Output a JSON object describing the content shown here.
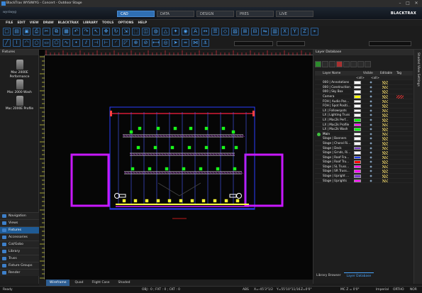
{
  "window": {
    "title": "BlackTrax WYSIWYG - Concert - Outdoor Stage",
    "controls": [
      "–",
      "□",
      "✕"
    ]
  },
  "brand": {
    "logo_left": "wysiwyg",
    "logo_right": "BLACKTRAX"
  },
  "mode_tabs": [
    {
      "label": "CAD",
      "active": true
    },
    {
      "label": "DATA",
      "active": false
    },
    {
      "label": "DESIGN",
      "active": false
    },
    {
      "label": "PRES",
      "active": false
    },
    {
      "label": "LIVE",
      "active": false
    }
  ],
  "menu": [
    "FILE",
    "EDIT",
    "VIEW",
    "DRAW",
    "BLACKTRAX",
    "LIBRARY",
    "TOOLS",
    "OPTIONS",
    "HELP"
  ],
  "toolbar": {
    "row1_icons": [
      "new-icon",
      "open-icon",
      "save-icon",
      "print-icon",
      "cut-icon",
      "copy-icon",
      "paste-icon",
      "undo-icon",
      "redo-icon",
      "select-icon",
      "move-icon",
      "rotate-icon",
      "scale-icon",
      "box-icon",
      "cylinder-icon",
      "sphere-icon",
      "cone-icon",
      "light-icon",
      "camera-icon",
      "text-icon",
      "dimension-icon",
      "layer-icon",
      "symbol-icon",
      "hatch-icon",
      "group-icon",
      "ungroup-icon",
      "mirror-icon",
      "array-icon",
      "x-axis-icon",
      "y-axis-icon",
      "z-axis-icon",
      "snap-icon"
    ],
    "row1_glyphs": [
      "□",
      "▤",
      "▣",
      "⎙",
      "✂",
      "⧉",
      "▦",
      "↶",
      "↷",
      "↖",
      "✥",
      "↻",
      "⇲",
      "⬚",
      "◫",
      "◍",
      "△",
      "✦",
      "◉",
      "A",
      "↔",
      "☰",
      "◇",
      "▨",
      "⊞",
      "⊟",
      "⇋",
      "▥",
      "X",
      "Y",
      "Z",
      "⌖"
    ],
    "row2_icons": [
      "line-icon",
      "polyline-icon",
      "arc-icon",
      "circle-icon",
      "rectangle-icon",
      "polygon-icon",
      "spline-icon",
      "point-icon",
      "offset-icon",
      "trim-icon",
      "extend-icon",
      "fillet-icon",
      "chamfer-icon",
      "join-icon",
      "break-icon",
      "measure-icon",
      "focus-icon",
      "aim-icon",
      "pipe-icon",
      "truss-icon",
      "hang-icon"
    ],
    "row2_glyphs": [
      "╱",
      "⌇",
      "◠",
      "○",
      "▭",
      "⬠",
      "∿",
      "•",
      "⫽",
      "⊣",
      "⊢",
      "◜",
      "◸",
      "⊕",
      "⊘",
      "⟷",
      "◎",
      "➤",
      "═",
      "⋈",
      "⚓"
    ]
  },
  "left_panel": {
    "title": "Fixtures",
    "fixtures": [
      "Mac 2000E Performance",
      "Mac 2000 Wash",
      "Mac 2000E Profile"
    ],
    "nav": [
      {
        "label": "Navigation",
        "active": false
      },
      {
        "label": "Views",
        "active": false
      },
      {
        "label": "Fixtures",
        "active": true
      },
      {
        "label": "Accessories",
        "active": false
      },
      {
        "label": "Col/Gobo",
        "active": false
      },
      {
        "label": "Library",
        "active": false
      },
      {
        "label": "Truss",
        "active": false
      },
      {
        "label": "Fixture Groups",
        "active": false
      },
      {
        "label": "Render",
        "active": false
      }
    ]
  },
  "view_tabs": [
    {
      "label": "Wireframe",
      "active": true
    },
    {
      "label": "Quad",
      "active": false
    },
    {
      "label": "Flight Case",
      "active": false
    },
    {
      "label": "Shaded",
      "active": false
    }
  ],
  "layer_database": {
    "title": "Layer Database",
    "columns": [
      "Layer Name",
      "Visible",
      "Editable",
      "Tag"
    ],
    "filter_value": "<all>",
    "layers": [
      {
        "name": "000 | Annotations",
        "color": "#ffffff"
      },
      {
        "name": "000 | Construction",
        "color": "#ffffff"
      },
      {
        "name": "000 | Sky Box",
        "color": "#ffffff"
      },
      {
        "name": "Camera",
        "color": "#ffff00"
      },
      {
        "name": "FOH | Audio Pos...",
        "color": "#ffffff"
      },
      {
        "name": "FOH | Spot Positi...",
        "color": "#ffffff"
      },
      {
        "name": "LX | Followspots",
        "color": "#ffffff"
      },
      {
        "name": "LX | Lighting Truss",
        "color": "#ffffff"
      },
      {
        "name": "LX | Mac2k Perf...",
        "color": "#00ff00"
      },
      {
        "name": "LX | Mac2k Profile",
        "color": "#ff00ff"
      },
      {
        "name": "LX | Mac2k Wash",
        "color": "#00ff00"
      },
      {
        "name": "Main",
        "color": "#ffffff",
        "active": true
      },
      {
        "name": "Stage | Banners",
        "color": "#ffffff"
      },
      {
        "name": "Stage | Choral Ri...",
        "color": "#ffffff"
      },
      {
        "name": "Stage | Deck",
        "color": "#7a3cc8"
      },
      {
        "name": "Stage | Grnds, Ri...",
        "color": "#ffffff"
      },
      {
        "name": "Stage | Roof Fra...",
        "color": "#2040ff"
      },
      {
        "name": "Stage | Roof Tru...",
        "color": "#ff0000"
      },
      {
        "name": "Stage | SL Truss...",
        "color": "#ff00ff"
      },
      {
        "name": "Stage | SR Truss...",
        "color": "#ff00ff"
      },
      {
        "name": "Stage | Upright ...",
        "color": "#7a3cc8"
      },
      {
        "name": "Stage | Uprights",
        "color": "#ff00ff"
      }
    ],
    "tabs": [
      {
        "label": "Library Browser",
        "active": false
      },
      {
        "label": "Layer Database",
        "active": true
      }
    ]
  },
  "side_strip_label": "Shaded View Settings",
  "status": {
    "ready": "Ready",
    "selection": "OBJ : 0 ; FXT : 0 ; CKT : 0",
    "abs": "ABS",
    "x": "X=-45'3\"1/2",
    "y": "Y=55'10\"11/16",
    "z": "Z=0'0\"",
    "mc": "MC Z = 0'0\"",
    "units": "Imperial",
    "ortho": "ORTHO",
    "snap": "NOR"
  },
  "colors": {
    "accent": "#2f6fb3",
    "fixture_green": "#19ff19",
    "truss_magenta": "#d218ff",
    "stage_blue": "#2b3dff"
  }
}
